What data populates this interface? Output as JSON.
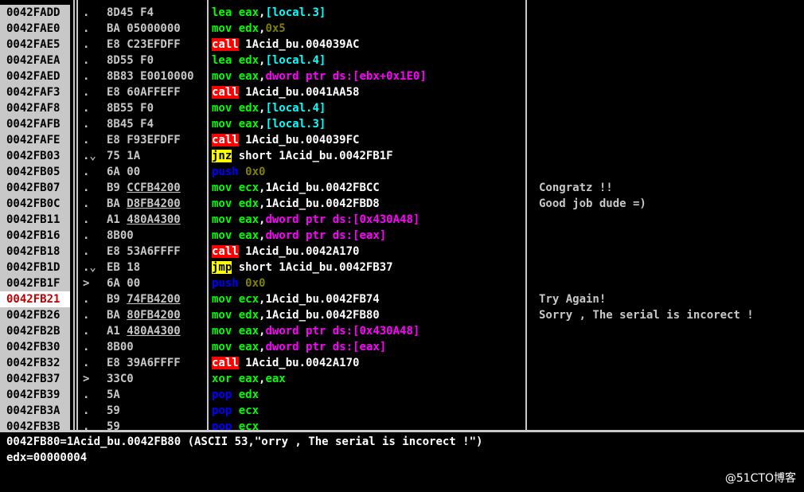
{
  "rows": [
    {
      "addr": "0042FADD",
      "jmp": ".",
      "hex": [
        "8D45 F4"
      ],
      "ops": [
        [
          "mov",
          "lea "
        ],
        [
          "reg",
          "eax"
        ],
        [
          "plain",
          ","
        ],
        [
          "mem",
          "[local.3]"
        ]
      ],
      "comment": ""
    },
    {
      "addr": "0042FAE0",
      "jmp": ".",
      "hex": [
        "BA 05000000"
      ],
      "ops": [
        [
          "mov",
          "mov "
        ],
        [
          "reg",
          "edx"
        ],
        [
          "plain",
          ","
        ],
        [
          "num",
          "0x5"
        ]
      ],
      "comment": ""
    },
    {
      "addr": "0042FAE5",
      "jmp": ".",
      "hex": [
        "E8 C23EFDFF"
      ],
      "ops": [
        [
          "call",
          "call"
        ],
        [
          "plain",
          " 1Acid_bu.004039AC"
        ]
      ],
      "comment": ""
    },
    {
      "addr": "0042FAEA",
      "jmp": ".",
      "hex": [
        "8D55 F0"
      ],
      "ops": [
        [
          "mov",
          "lea "
        ],
        [
          "reg",
          "edx"
        ],
        [
          "plain",
          ","
        ],
        [
          "mem",
          "[local.4]"
        ]
      ],
      "comment": ""
    },
    {
      "addr": "0042FAED",
      "jmp": ".",
      "hex": [
        "8B83 E0010000"
      ],
      "ops": [
        [
          "mov",
          "mov "
        ],
        [
          "reg",
          "eax"
        ],
        [
          "plain",
          ","
        ],
        [
          "ptr",
          "dword ptr ds:[ebx+0x1E0]"
        ]
      ],
      "comment": ""
    },
    {
      "addr": "0042FAF3",
      "jmp": ".",
      "hex": [
        "E8 60AFFEFF"
      ],
      "ops": [
        [
          "call",
          "call"
        ],
        [
          "plain",
          " 1Acid_bu.0041AA58"
        ]
      ],
      "comment": ""
    },
    {
      "addr": "0042FAF8",
      "jmp": ".",
      "hex": [
        "8B55 F0"
      ],
      "ops": [
        [
          "mov",
          "mov "
        ],
        [
          "reg",
          "edx"
        ],
        [
          "plain",
          ","
        ],
        [
          "mem",
          "[local.4]"
        ]
      ],
      "comment": ""
    },
    {
      "addr": "0042FAFB",
      "jmp": ".",
      "hex": [
        "8B45 F4"
      ],
      "ops": [
        [
          "mov",
          "mov "
        ],
        [
          "reg",
          "eax"
        ],
        [
          "plain",
          ","
        ],
        [
          "mem",
          "[local.3]"
        ]
      ],
      "comment": ""
    },
    {
      "addr": "0042FAFE",
      "jmp": ".",
      "hex": [
        "E8 F93EFDFF"
      ],
      "ops": [
        [
          "call",
          "call"
        ],
        [
          "plain",
          " 1Acid_bu.004039FC"
        ]
      ],
      "comment": ""
    },
    {
      "addr": "0042FB03",
      "jmp": ".⌄",
      "hex": [
        "75 1A"
      ],
      "ops": [
        [
          "jmp",
          "jnz"
        ],
        [
          "plain",
          " short 1Acid_bu.0042FB1F"
        ]
      ],
      "comment": ""
    },
    {
      "addr": "0042FB05",
      "jmp": ".",
      "hex": [
        "6A 00"
      ],
      "ops": [
        [
          "push",
          "push "
        ],
        [
          "num",
          "0x0"
        ]
      ],
      "comment": ""
    },
    {
      "addr": "0042FB07",
      "jmp": ".",
      "hex": [
        "B9 ",
        {
          "u": "CCFB4200"
        }
      ],
      "ops": [
        [
          "mov",
          "mov "
        ],
        [
          "reg",
          "ecx"
        ],
        [
          "plain",
          ",1Acid_bu.0042FBCC"
        ]
      ],
      "comment": "Congratz !!"
    },
    {
      "addr": "0042FB0C",
      "jmp": ".",
      "hex": [
        "BA ",
        {
          "u": "D8FB4200"
        }
      ],
      "ops": [
        [
          "mov",
          "mov "
        ],
        [
          "reg",
          "edx"
        ],
        [
          "plain",
          ",1Acid_bu.0042FBD8"
        ]
      ],
      "comment": "Good job dude =)"
    },
    {
      "addr": "0042FB11",
      "jmp": ".",
      "hex": [
        "A1 ",
        {
          "u": "480A4300"
        }
      ],
      "ops": [
        [
          "mov",
          "mov "
        ],
        [
          "reg",
          "eax"
        ],
        [
          "plain",
          ","
        ],
        [
          "ptr",
          "dword ptr ds:[0x430A48]"
        ]
      ],
      "comment": ""
    },
    {
      "addr": "0042FB16",
      "jmp": ".",
      "hex": [
        "8B00"
      ],
      "ops": [
        [
          "mov",
          "mov "
        ],
        [
          "reg",
          "eax"
        ],
        [
          "plain",
          ","
        ],
        [
          "ptr",
          "dword ptr ds:[eax]"
        ]
      ],
      "comment": ""
    },
    {
      "addr": "0042FB18",
      "jmp": ".",
      "hex": [
        "E8 53A6FFFF"
      ],
      "ops": [
        [
          "call",
          "call"
        ],
        [
          "plain",
          " 1Acid_bu.0042A170"
        ]
      ],
      "comment": ""
    },
    {
      "addr": "0042FB1D",
      "jmp": ".⌄",
      "hex": [
        "EB 18"
      ],
      "ops": [
        [
          "jmp",
          "jmp"
        ],
        [
          "plain",
          " short 1Acid_bu.0042FB37"
        ]
      ],
      "comment": ""
    },
    {
      "addr": "0042FB1F",
      "jmp": ">",
      "hex": [
        "6A 00"
      ],
      "ops": [
        [
          "push",
          "push "
        ],
        [
          "num",
          "0x0"
        ]
      ],
      "comment": ""
    },
    {
      "addr": "0042FB21",
      "jmp": ".",
      "hex": [
        "B9 ",
        {
          "u": "74FB4200"
        }
      ],
      "ops": [
        [
          "mov",
          "mov "
        ],
        [
          "reg",
          "ecx"
        ],
        [
          "plain",
          ",1Acid_bu.0042FB74"
        ]
      ],
      "comment": "Try Again!",
      "hl": true
    },
    {
      "addr": "0042FB26",
      "jmp": ".",
      "hex": [
        "BA ",
        {
          "u": "80FB4200"
        }
      ],
      "ops": [
        [
          "mov",
          "mov "
        ],
        [
          "reg",
          "edx"
        ],
        [
          "plain",
          ",1Acid_bu.0042FB80"
        ]
      ],
      "comment": "Sorry , The serial is incorect !"
    },
    {
      "addr": "0042FB2B",
      "jmp": ".",
      "hex": [
        "A1 ",
        {
          "u": "480A4300"
        }
      ],
      "ops": [
        [
          "mov",
          "mov "
        ],
        [
          "reg",
          "eax"
        ],
        [
          "plain",
          ","
        ],
        [
          "ptr",
          "dword ptr ds:[0x430A48]"
        ]
      ],
      "comment": ""
    },
    {
      "addr": "0042FB30",
      "jmp": ".",
      "hex": [
        "8B00"
      ],
      "ops": [
        [
          "mov",
          "mov "
        ],
        [
          "reg",
          "eax"
        ],
        [
          "plain",
          ","
        ],
        [
          "ptr",
          "dword ptr ds:[eax]"
        ]
      ],
      "comment": ""
    },
    {
      "addr": "0042FB32",
      "jmp": ".",
      "hex": [
        "E8 39A6FFFF"
      ],
      "ops": [
        [
          "call",
          "call"
        ],
        [
          "plain",
          " 1Acid_bu.0042A170"
        ]
      ],
      "comment": ""
    },
    {
      "addr": "0042FB37",
      "jmp": ">",
      "hex": [
        "33C0"
      ],
      "ops": [
        [
          "mov",
          "xor "
        ],
        [
          "reg",
          "eax"
        ],
        [
          "plain",
          ","
        ],
        [
          "reg",
          "eax"
        ]
      ],
      "comment": ""
    },
    {
      "addr": "0042FB39",
      "jmp": ".",
      "hex": [
        "5A"
      ],
      "ops": [
        [
          "push",
          "pop "
        ],
        [
          "reg",
          "edx"
        ]
      ],
      "comment": ""
    },
    {
      "addr": "0042FB3A",
      "jmp": ".",
      "hex": [
        "59"
      ],
      "ops": [
        [
          "push",
          "pop "
        ],
        [
          "reg",
          "ecx"
        ]
      ],
      "comment": ""
    },
    {
      "addr": "0042FB3B",
      "jmp": ".",
      "hex": [
        "59"
      ],
      "ops": [
        [
          "push",
          "pop "
        ],
        [
          "reg",
          "ecx"
        ]
      ],
      "comment": ""
    }
  ],
  "info": {
    "line1": "0042FB80=1Acid_bu.0042FB80 (ASCII 53,\"orry , The serial is incorect !\")",
    "line2": "edx=00000004"
  },
  "watermark": "@51CTO博客"
}
